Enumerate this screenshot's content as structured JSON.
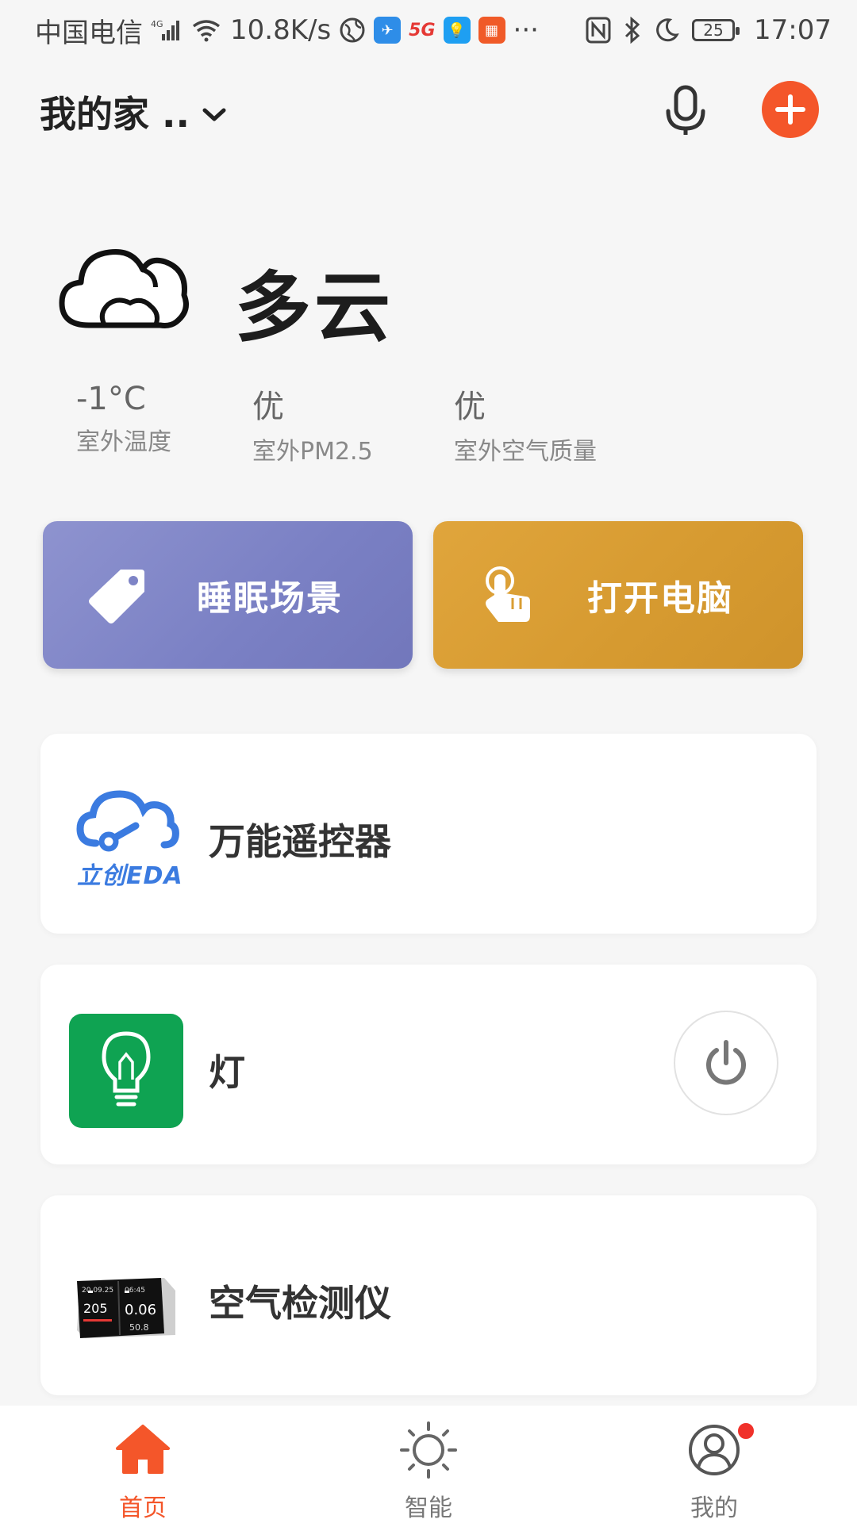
{
  "status_bar": {
    "carrier": "中国电信",
    "network": "4G",
    "speed": "10.8K/s",
    "battery": "25",
    "time": "17:07",
    "more": "···"
  },
  "header": {
    "home_title": "我的家 ..",
    "icons": [
      "chevron-down-icon",
      "microphone-icon",
      "add-icon"
    ]
  },
  "weather": {
    "condition": "多云",
    "stats": [
      {
        "value": "-1°C",
        "label": "室外温度"
      },
      {
        "value": "优",
        "label": "室外PM2.5"
      },
      {
        "value": "优",
        "label": "室外空气质量"
      }
    ]
  },
  "scenes": [
    {
      "label": "睡眠场景",
      "icon": "tag-icon",
      "color": "#7e84c6"
    },
    {
      "label": "打开电脑",
      "icon": "touch-hand-icon",
      "color": "#d99e33"
    }
  ],
  "devices": [
    {
      "name": "万能遥控器",
      "logo_text": "立创EDA"
    },
    {
      "name": "灯",
      "has_power_button": true
    },
    {
      "name": "空气检测仪",
      "image_text": [
        "20.09.25",
        "06:45",
        "205",
        "0.06",
        "50.8"
      ]
    }
  ],
  "bottom_nav": [
    {
      "label": "首页",
      "icon": "home-icon",
      "active": true
    },
    {
      "label": "智能",
      "icon": "sun-icon",
      "active": false
    },
    {
      "label": "我的",
      "icon": "user-icon",
      "active": false,
      "badge": true
    }
  ],
  "colors": {
    "accent": "#f4562a",
    "lamp_bg": "#0fa352",
    "background": "#f6f6f6"
  }
}
